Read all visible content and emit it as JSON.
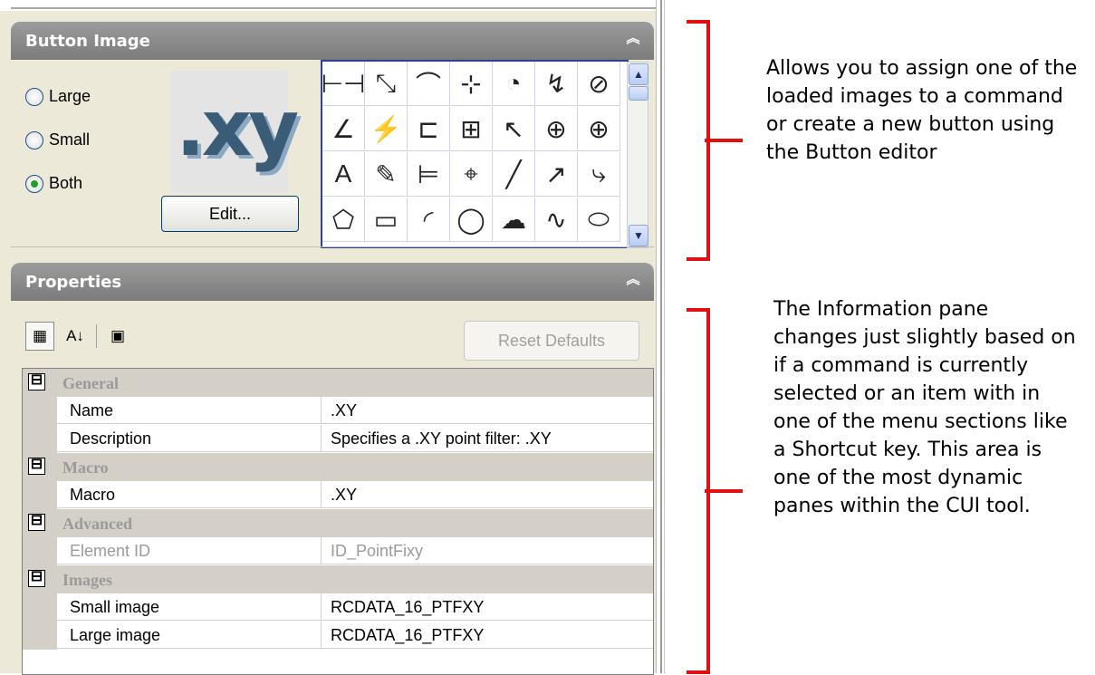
{
  "button_image": {
    "title": "Button Image",
    "collapse_glyph": "⌃",
    "size_options": [
      {
        "label": "Large",
        "selected": false
      },
      {
        "label": "Small",
        "selected": false
      },
      {
        "label": "Both",
        "selected": true
      }
    ],
    "preview_text": ".xy",
    "edit_label": "Edit...",
    "icons": [
      [
        "dim-linear-icon",
        "dim-aligned-icon",
        "dim-arc-icon",
        "dim-ordinate-icon",
        "dim-radius-icon",
        "dim-jogged-icon",
        "dim-diameter-icon"
      ],
      [
        "dim-angular-icon",
        "quick-dim-icon",
        "dim-baseline-icon",
        "dim-continue-icon",
        "qleader-icon",
        "tolerance-icon",
        "center-mark-icon"
      ],
      [
        "dim-edit-icon",
        "dim-text-edit-icon",
        "dim-update-icon",
        "dim-style-icon",
        "line-icon",
        "ray-icon",
        "polyline-icon"
      ],
      [
        "polygon-icon",
        "rectangle-icon",
        "arc-icon",
        "circle-icon",
        "revcloud-icon",
        "spline-icon",
        "ellipse-icon"
      ]
    ]
  },
  "properties": {
    "title": "Properties",
    "collapse_glyph": "⌃",
    "toolbar": {
      "categorized_icon": "▦",
      "sort_icon": "A↓",
      "pages_icon": "▣",
      "reset_label": "Reset Defaults"
    },
    "categories": [
      {
        "expander": "⊟",
        "name": "General",
        "rows": [
          {
            "name": "Name",
            "value": ".XY",
            "dim": false
          },
          {
            "name": "Description",
            "value": "Specifies a .XY point filter:  .XY",
            "dim": false
          }
        ]
      },
      {
        "expander": "⊟",
        "name": "Macro",
        "rows": [
          {
            "name": "Macro",
            "value": ".XY",
            "dim": false
          }
        ]
      },
      {
        "expander": "⊟",
        "name": "Advanced",
        "rows": [
          {
            "name": "Element ID",
            "value": "ID_PointFixy",
            "dim": true
          }
        ]
      },
      {
        "expander": "⊟",
        "name": "Images",
        "rows": [
          {
            "name": "Small image",
            "value": "RCDATA_16_PTFXY",
            "dim": false
          },
          {
            "name": "Large image",
            "value": "RCDATA_16_PTFXY",
            "dim": false
          }
        ]
      }
    ]
  },
  "annotations": {
    "top_note": [
      "Allows you to assign one of the",
      "loaded images to a command",
      "or create a new button using",
      "the Button editor"
    ],
    "bottom_note": [
      "The Information pane",
      "changes just slightly based on",
      "if a command is currently",
      "selected or an item with in",
      "one of the menu sections like",
      "a Shortcut key.  This area is",
      "one of the most dynamic",
      "panes within the CUI tool."
    ],
    "bracket_color": "#e01010"
  }
}
